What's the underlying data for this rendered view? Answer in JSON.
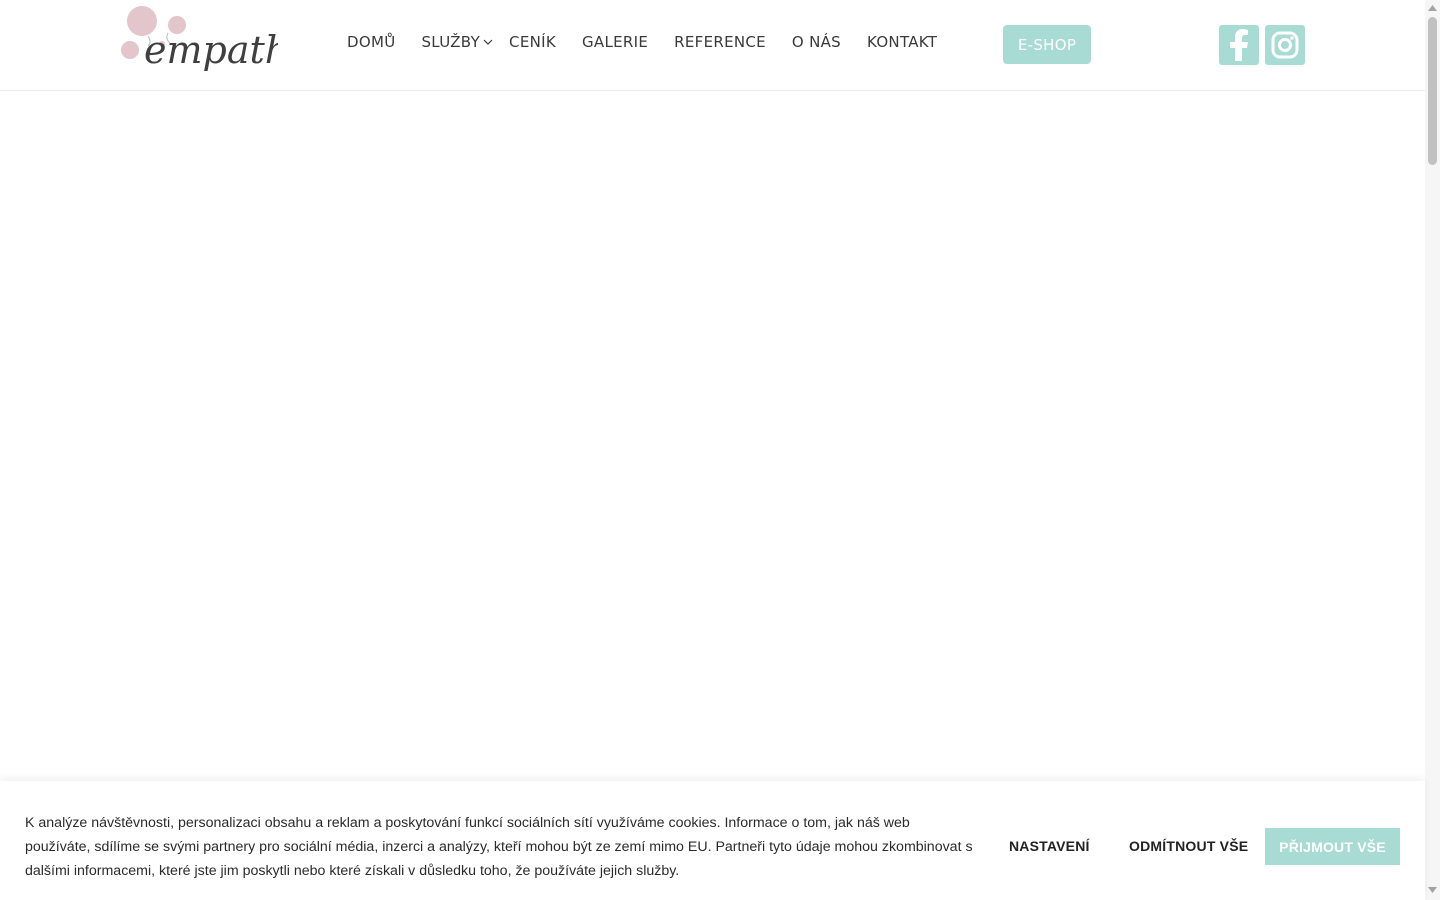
{
  "brand": {
    "logo_text": "empathy",
    "accent_color": "#a8dbd3",
    "bubble_color": "#e2c6cc"
  },
  "nav": {
    "items": [
      {
        "label": "DOMŮ"
      },
      {
        "label": "SLUŽBY",
        "has_dropdown": true
      },
      {
        "label": "CENÍK"
      },
      {
        "label": "GALERIE"
      },
      {
        "label": "REFERENCE"
      },
      {
        "label": "O NÁS"
      },
      {
        "label": "KONTAKT"
      }
    ],
    "eshop_label": "E-SHOP"
  },
  "social": {
    "icons": [
      "facebook-icon",
      "instagram-icon"
    ]
  },
  "cookie": {
    "text": "K analýze návštěvnosti, personalizaci obsahu a reklam a poskytování funkcí sociálních sítí využíváme cookies. Informace o tom, jak náš web používáte, sdílíme se svými partnery pro sociální média, inzerci a analýzy, kteří mohou být ze zemí mimo EU. Partneři tyto údaje mohou zkombinovat s dalšími informacemi, které jste jim poskytli nebo které získali v důsledku toho, že používáte jejich služby.",
    "settings_label": "NASTAVENÍ",
    "reject_label": "ODMÍTNOUT VŠE",
    "accept_label": "PŘIJMOUT VŠE"
  }
}
